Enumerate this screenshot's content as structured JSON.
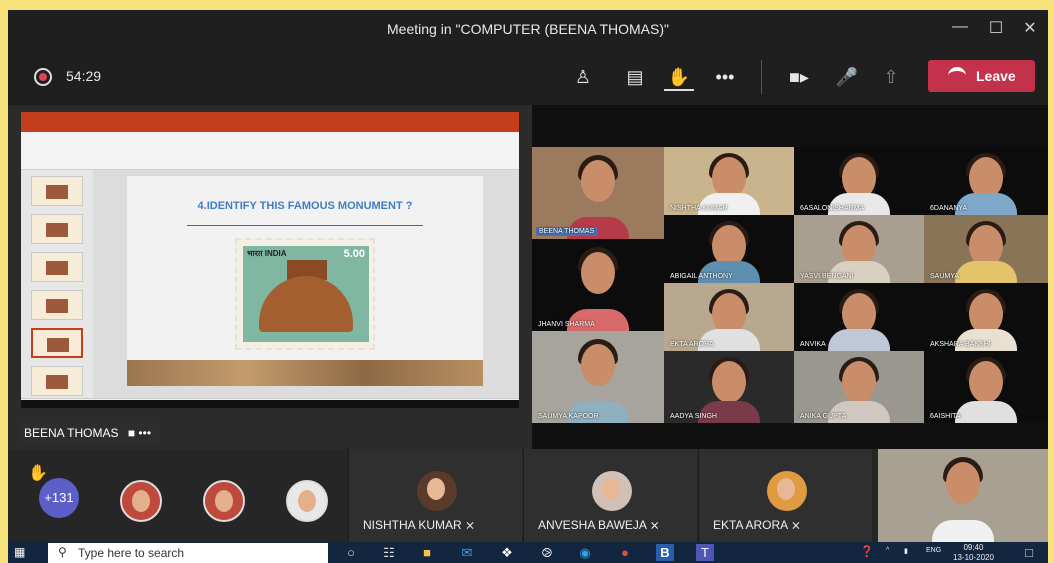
{
  "window": {
    "title": "Meeting in \"COMPUTER (BEENA THOMAS)\""
  },
  "toolbar": {
    "timer": "54:29",
    "leave_label": "Leave"
  },
  "share": {
    "slide_question": "4.IDENTIFY THIS FAMOUS MONUMENT ?",
    "stamp_country": "भारत INDIA",
    "stamp_value": "5.00",
    "presenter_name": "BEENA THOMAS"
  },
  "gallery": [
    {
      "name": "BEENA THOMAS"
    },
    {
      "name": "NISHTHA KUMAR"
    },
    {
      "name": "6ASALONISHARMA"
    },
    {
      "name": "6DANANYA"
    },
    {
      "name": "ABIGAIL ANTHONY"
    },
    {
      "name": "YASVI BENGANI"
    },
    {
      "name": "SAUMYA"
    },
    {
      "name": "JHANVI SHARMA"
    },
    {
      "name": "EKTA ARORA"
    },
    {
      "name": "ANVIKA"
    },
    {
      "name": "AKSHARA BAKSHI"
    },
    {
      "name": "SAUMYA KAPOOR"
    },
    {
      "name": "AADYA SINGH"
    },
    {
      "name": "ANIKA GUPTA"
    },
    {
      "name": "6AISHITA"
    }
  ],
  "strip": {
    "overflow_count": "+131",
    "participants": [
      {
        "name": "NISHTHA KUMAR"
      },
      {
        "name": "ANVESHA BAWEJA"
      },
      {
        "name": "EKTA ARORA"
      }
    ]
  },
  "taskbar": {
    "search_placeholder": "Type here to search",
    "language": "ENG",
    "time": "09:40",
    "date": "13-10-2020"
  },
  "colors": {
    "leave": "#c4314b",
    "accent": "#5b5fc7",
    "raised_hand": "#f2c12e"
  }
}
